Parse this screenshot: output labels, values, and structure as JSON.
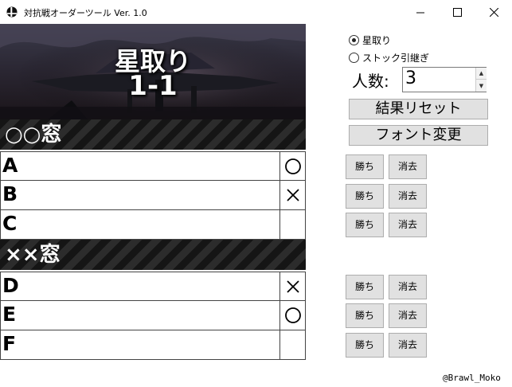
{
  "window": {
    "title": "対抗戦オーダーツール Ver. 1.0"
  },
  "banner": {
    "line1": "星取り",
    "line2": "1-1"
  },
  "teams": [
    {
      "name": "○○窓"
    },
    {
      "name": "××窓"
    }
  ],
  "players": [
    {
      "name": "A",
      "result": "○"
    },
    {
      "name": "B",
      "result": "×"
    },
    {
      "name": "C",
      "result": ""
    },
    {
      "name": "D",
      "result": "×"
    },
    {
      "name": "E",
      "result": "○"
    },
    {
      "name": "F",
      "result": ""
    }
  ],
  "mode": {
    "options": [
      "星取り",
      "ストック引継ぎ"
    ],
    "selected": "星取り"
  },
  "count": {
    "label": "人数:",
    "value": "3"
  },
  "buttons": {
    "reset": "結果リセット",
    "font": "フォント変更",
    "win": "勝ち",
    "clear": "消去"
  },
  "footer": "@Brawl_Moko",
  "colors": {
    "stripe_dark": "#151515",
    "stripe_light": "#2c2c2c",
    "button_face": "#e1e1e1"
  }
}
